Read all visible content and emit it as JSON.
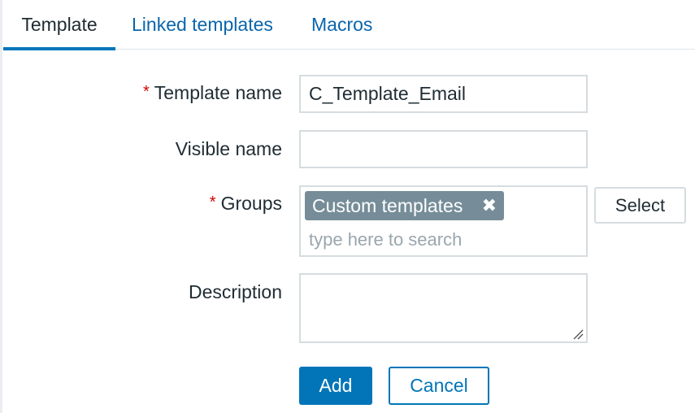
{
  "tabs": [
    {
      "label": "Template",
      "active": true
    },
    {
      "label": "Linked templates",
      "active": false
    },
    {
      "label": "Macros",
      "active": false
    }
  ],
  "form": {
    "required_marker": "*",
    "template_name": {
      "label": "Template name",
      "value": "C_Template_Email",
      "required": true
    },
    "visible_name": {
      "label": "Visible name",
      "value": "",
      "required": false
    },
    "groups": {
      "label": "Groups",
      "required": true,
      "selected": [
        {
          "label": "Custom templates",
          "remove_icon": "✖"
        }
      ],
      "placeholder": "type here to search",
      "select_label": "Select"
    },
    "description": {
      "label": "Description",
      "value": ""
    }
  },
  "buttons": {
    "add": "Add",
    "cancel": "Cancel"
  },
  "colors": {
    "accent": "#0275b8",
    "link": "#0a66ad",
    "required": "#d40000",
    "chip": "#768d99",
    "border": "#d6dcdf"
  },
  "icons": {
    "chip_remove": "close-icon",
    "resize": "resize-grip-icon"
  }
}
